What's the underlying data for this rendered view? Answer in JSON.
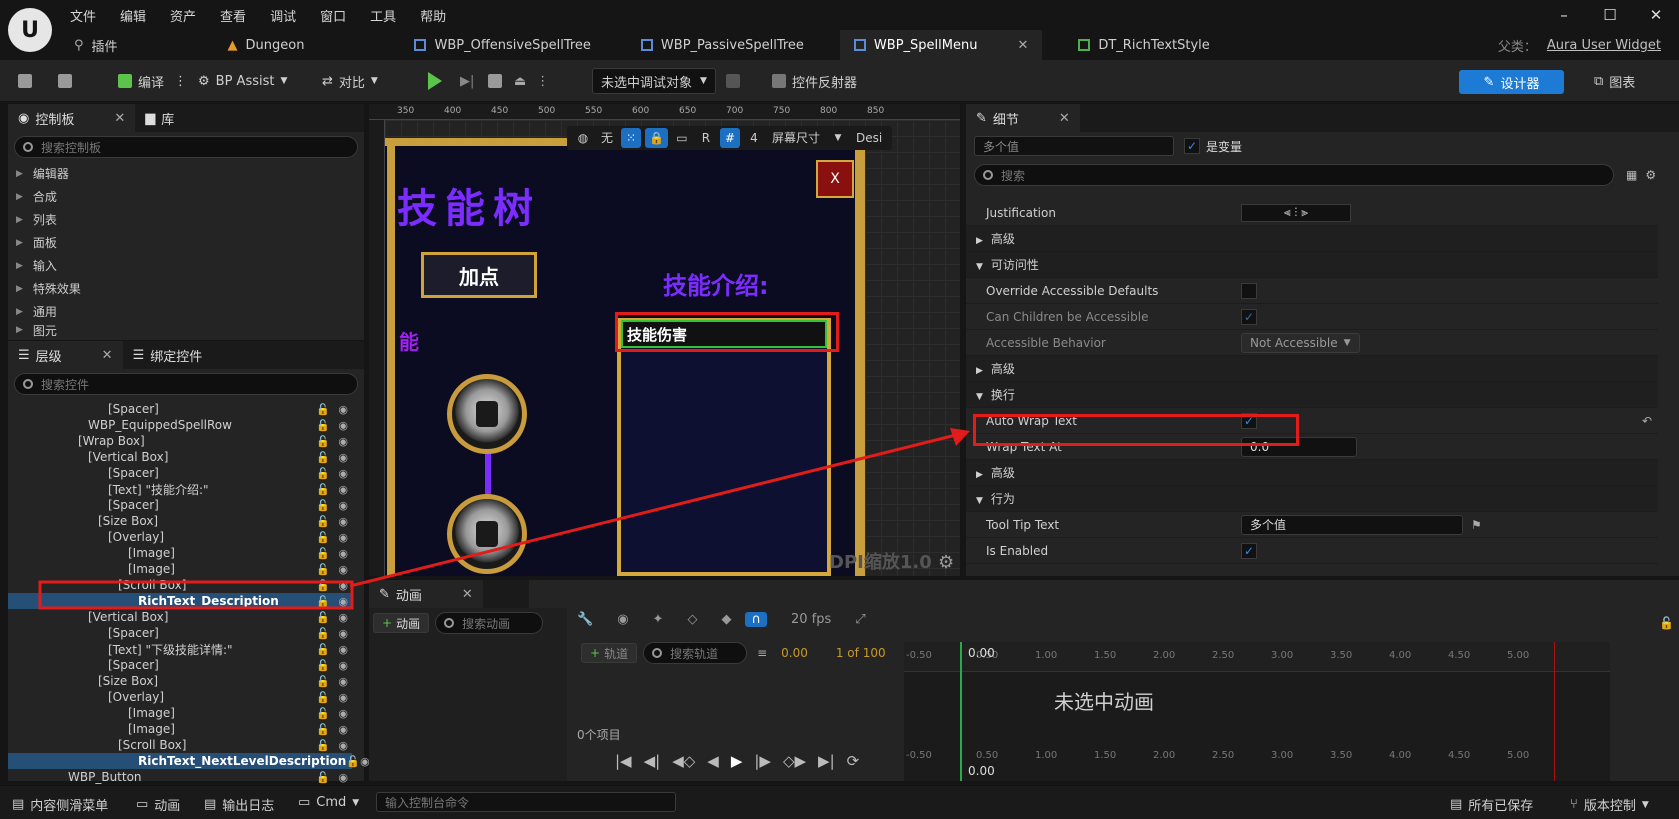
{
  "menu": [
    "文件",
    "编辑",
    "资产",
    "查看",
    "调试",
    "窗口",
    "工具",
    "帮助"
  ],
  "tabs": [
    {
      "label": "插件"
    },
    {
      "label": "Dungeon"
    },
    {
      "label": "WBP_OffensiveSpellTree"
    },
    {
      "label": "WBP_PassiveSpellTree"
    },
    {
      "label": "WBP_SpellMenu",
      "close": "✕"
    },
    {
      "label": "DT_RichTextStyle"
    }
  ],
  "parent_class": {
    "label": "父类：",
    "value": "Aura User Widget"
  },
  "toolbar": {
    "compile": "编译",
    "bp_assist": "BP Assist",
    "diff": "对比",
    "debug_object": "未选中调试对象",
    "widget_reflector": "控件反射器",
    "designer": "设计器",
    "graph": "图表"
  },
  "palette": {
    "tab_palette": "控制板",
    "tab_library": "库",
    "search_placeholder": "搜索控制板",
    "categories": [
      "编辑器",
      "合成",
      "列表",
      "面板",
      "输入",
      "特殊效果",
      "通用",
      "图元"
    ]
  },
  "hierarchy": {
    "tab_hierarchy": "层级",
    "tab_bindings": "绑定控件",
    "search_placeholder": "搜索控件",
    "items": [
      {
        "label": "[Spacer]",
        "indent": 10
      },
      {
        "label": "WBP_EquippedSpellRow",
        "indent": 8
      },
      {
        "label": "[Wrap Box]",
        "indent": 7
      },
      {
        "label": "[Vertical Box]",
        "indent": 8
      },
      {
        "label": "[Spacer]",
        "indent": 10
      },
      {
        "label": "[Text] \"技能介绍:\"",
        "indent": 10
      },
      {
        "label": "[Spacer]",
        "indent": 10
      },
      {
        "label": "[Size Box]",
        "indent": 9
      },
      {
        "label": "[Overlay]",
        "indent": 10
      },
      {
        "label": "[Image]",
        "indent": 12
      },
      {
        "label": "[Image]",
        "indent": 12
      },
      {
        "label": "[Scroll Box]",
        "indent": 11
      },
      {
        "label": "RichText_Description",
        "indent": 13,
        "selected": true
      },
      {
        "label": "[Vertical Box]",
        "indent": 8
      },
      {
        "label": "[Spacer]",
        "indent": 10
      },
      {
        "label": "[Text] \"下级技能详情:\"",
        "indent": 10
      },
      {
        "label": "[Spacer]",
        "indent": 10
      },
      {
        "label": "[Size Box]",
        "indent": 9
      },
      {
        "label": "[Overlay]",
        "indent": 10
      },
      {
        "label": "[Image]",
        "indent": 12
      },
      {
        "label": "[Image]",
        "indent": 12
      },
      {
        "label": "[Scroll Box]",
        "indent": 11
      },
      {
        "label": "RichText_NextLevelDescription",
        "indent": 13,
        "selected": true
      },
      {
        "label": "WBP_Button",
        "indent": 6
      }
    ]
  },
  "canvas": {
    "ruler_marks": [
      "350",
      "400",
      "450",
      "500",
      "550",
      "600",
      "650",
      "700",
      "750",
      "800",
      "850"
    ],
    "tool_none": "无",
    "tool_r": "R",
    "tool_4": "4",
    "screen_size": "屏幕尺寸",
    "design": "Desi",
    "close_x": "X",
    "title": "技能树",
    "add_point": "加点",
    "skill_intro": "技能介绍:",
    "skill_partial": "能",
    "rich_text": "技能伤害",
    "dpi": "DPI缩放1.0"
  },
  "details": {
    "tab": "细节",
    "name_placeholder": "多个值",
    "is_variable": "是变量",
    "search_placeholder": "搜索",
    "rows": {
      "justification": "Justification",
      "advanced1": "高级",
      "accessibility": "可访问性",
      "override_accessible": "Override Accessible Defaults",
      "children_accessible": "Can Children be Accessible",
      "accessible_behavior": "Accessible Behavior",
      "accessible_behavior_value": "Not Accessible",
      "advanced2": "高级",
      "wrapping": "换行",
      "auto_wrap": "Auto Wrap Text",
      "wrap_at": "Wrap Text At",
      "wrap_at_value": "0.0",
      "advanced3": "高级",
      "behavior": "行为",
      "tooltip": "Tool Tip Text",
      "tooltip_value": "多个值",
      "is_enabled": "Is Enabled"
    }
  },
  "animation": {
    "tab": "动画",
    "add": "动画",
    "search_placeholder": "搜索动画",
    "fps": "20 fps",
    "track": "轨道",
    "track_search": "搜索轨道",
    "time": "0.00",
    "frame": "1 of 100",
    "items_count": "0个项目",
    "no_selection": "未选中动画",
    "ruler_marks": [
      "-0.50",
      "0.50",
      "1.00",
      "1.50",
      "2.00",
      "2.50",
      "3.00",
      "3.50",
      "4.00",
      "4.50",
      "5.00"
    ],
    "current_time": "0.00"
  },
  "status": {
    "content_drawer": "内容侧滑菜单",
    "animation": "动画",
    "output_log": "输出日志",
    "cmd": "Cmd",
    "console_placeholder": "输入控制台命令",
    "all_saved": "所有已保存",
    "version_control": "版本控制"
  },
  "colors": {
    "accent": "#1d7bd6",
    "highlight": "#e21b1b",
    "gold": "#c89f3c",
    "purple": "#7b2cff"
  }
}
